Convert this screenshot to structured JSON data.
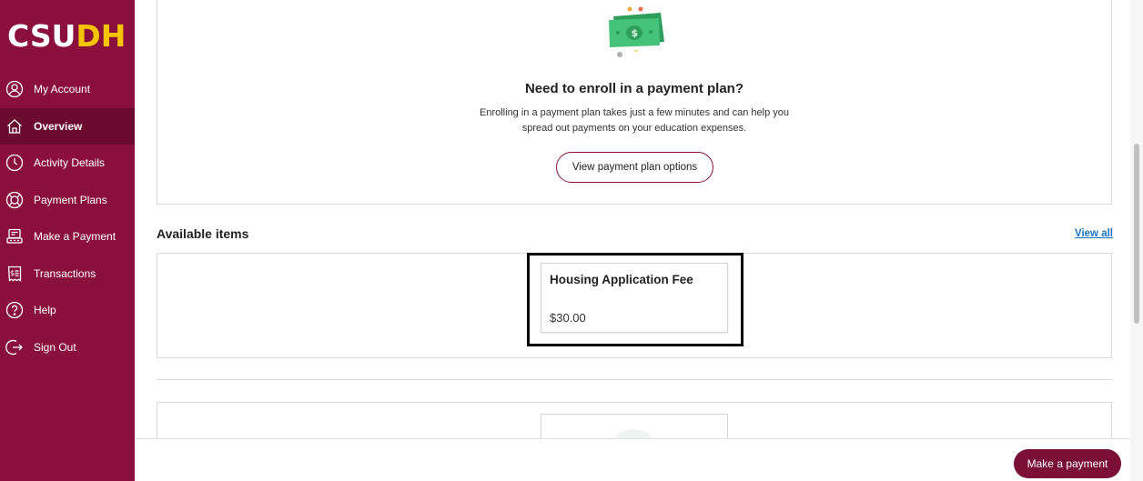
{
  "logo": {
    "part1": "CSU",
    "part2": "DH"
  },
  "nav": [
    {
      "label": "My Account",
      "icon": "user-icon"
    },
    {
      "label": "Overview",
      "icon": "home-icon",
      "active": true
    },
    {
      "label": "Activity Details",
      "icon": "clock-icon"
    },
    {
      "label": "Payment Plans",
      "icon": "lifebuoy-icon"
    },
    {
      "label": "Make a Payment",
      "icon": "payment-terminal-icon"
    },
    {
      "label": "Transactions",
      "icon": "receipt-icon"
    },
    {
      "label": "Help",
      "icon": "help-icon"
    },
    {
      "label": "Sign Out",
      "icon": "sign-out-icon"
    }
  ],
  "payment_plan": {
    "title": "Need to enroll in a payment plan?",
    "description_line1": "Enrolling in a payment plan takes just a few minutes and can help you",
    "description_line2": "spread out payments on your education expenses.",
    "button_label": "View payment plan options"
  },
  "available_items": {
    "title": "Available items",
    "view_all": "View all",
    "items": [
      {
        "name": "Housing Application Fee",
        "amount": "$30.00"
      }
    ]
  },
  "footer": {
    "make_payment_label": "Make a payment"
  },
  "colors": {
    "brand": "#8a0f3c",
    "brand_dark": "#6b0a2e",
    "accent_gold": "#f5c400",
    "link": "#1a73c8"
  }
}
